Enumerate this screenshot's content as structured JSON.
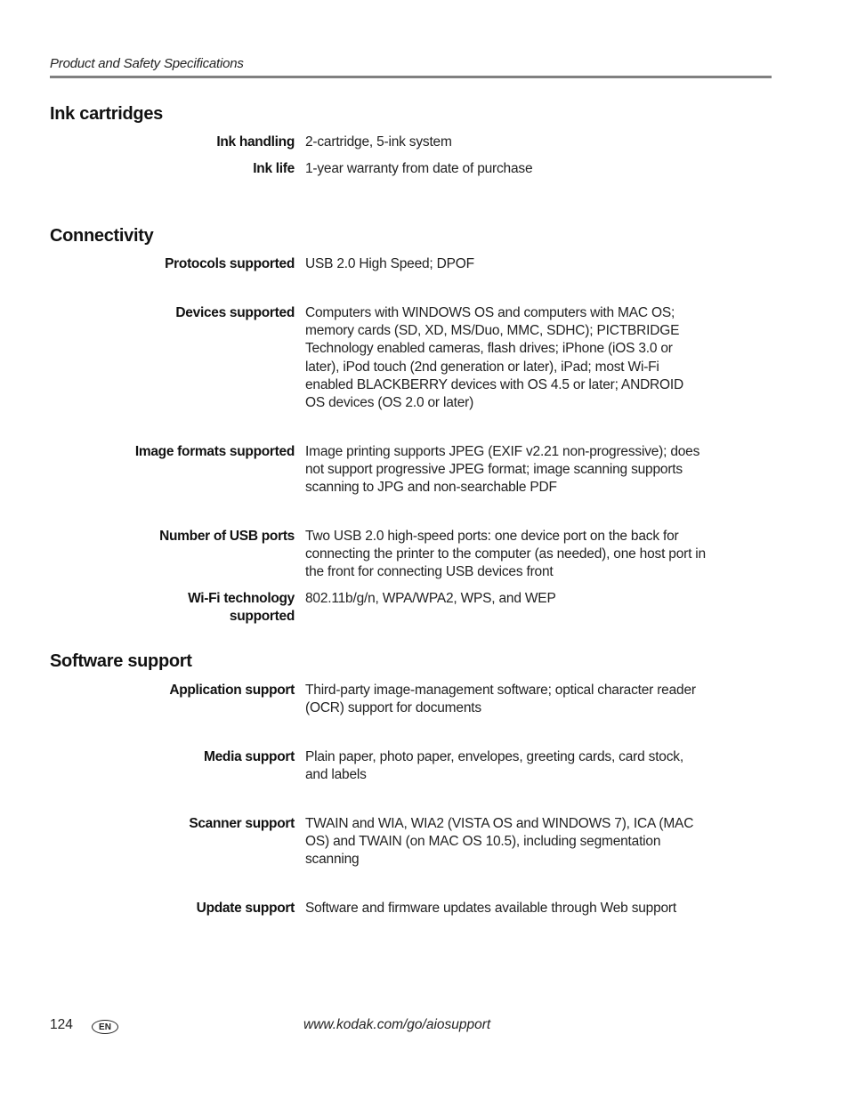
{
  "header": {
    "running_title": "Product and Safety Specifications"
  },
  "sections": [
    {
      "title": "Ink cartridges",
      "rows": [
        {
          "label": "Ink handling",
          "value": "2-cartridge, 5-ink system"
        },
        {
          "label": "Ink life",
          "value": "1-year warranty from date of purchase"
        }
      ]
    },
    {
      "title": "Connectivity",
      "rows": [
        {
          "label": "Protocols supported",
          "value": "USB 2.0 High Speed; DPOF"
        },
        {
          "label": "Devices supported",
          "value": "Computers with WINDOWS OS and computers with MAC OS; memory cards (SD, XD, MS/Duo, MMC, SDHC); PICTBRIDGE Technology enabled cameras, flash drives; iPhone (iOS 3.0 or later), iPod touch (2nd generation or later), iPad; most Wi-Fi enabled BLACKBERRY devices with OS 4.5 or later; ANDROID OS devices (OS 2.0 or later)"
        },
        {
          "label": "Image formats supported",
          "value": "Image printing supports JPEG (EXIF v2.21 non-progressive); does not support progressive JPEG format; image scanning supports scanning to JPG and non-searchable PDF"
        },
        {
          "label": "Number of USB ports",
          "value": "Two USB 2.0 high-speed ports: one device port on the back for connecting the printer to the computer (as needed), one host port in the front for connecting USB devices front"
        },
        {
          "label_line1": "Wi-Fi technology",
          "label_line2": "supported",
          "value": "802.11b/g/n, WPA/WPA2, WPS, and WEP"
        }
      ]
    },
    {
      "title": "Software support",
      "rows": [
        {
          "label": "Application support",
          "value": "Third-party image-management software; optical character reader (OCR) support for documents"
        },
        {
          "label": "Media support",
          "value": "Plain paper, photo paper, envelopes, greeting cards, card stock, and labels"
        },
        {
          "label": "Scanner support",
          "value": "TWAIN and WIA, WIA2 (VISTA OS and WINDOWS 7), ICA (MAC OS) and TWAIN (on MAC OS 10.5), including segmentation scanning"
        },
        {
          "label": "Update support",
          "value": "Software and firmware updates available through Web support"
        }
      ]
    }
  ],
  "footer": {
    "page_number": "124",
    "language_badge": "EN",
    "url": "www.kodak.com/go/aiosupport"
  }
}
